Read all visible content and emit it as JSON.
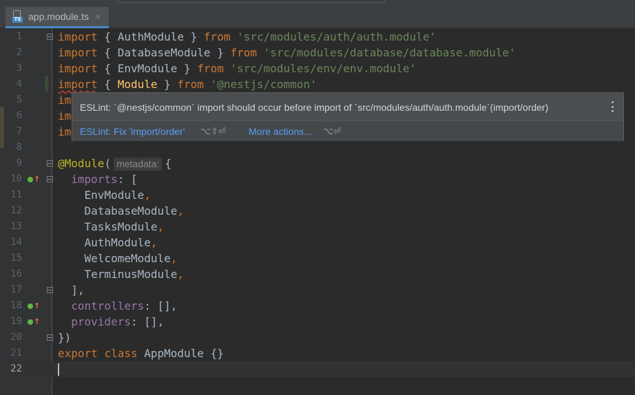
{
  "tab": {
    "file_name": "app.module.ts",
    "badge": "TS",
    "close": "×"
  },
  "code_lines": [
    {
      "num": "1"
    },
    {
      "num": "2"
    },
    {
      "num": "3"
    },
    {
      "num": "4"
    },
    {
      "num": "5"
    },
    {
      "num": "6"
    },
    {
      "num": "7"
    },
    {
      "num": "8"
    },
    {
      "num": "9"
    },
    {
      "num": "10"
    },
    {
      "num": "11"
    },
    {
      "num": "12"
    },
    {
      "num": "13"
    },
    {
      "num": "14"
    },
    {
      "num": "15"
    },
    {
      "num": "16"
    },
    {
      "num": "17"
    },
    {
      "num": "18"
    },
    {
      "num": "19"
    },
    {
      "num": "20"
    },
    {
      "num": "21"
    },
    {
      "num": "22"
    }
  ],
  "code": {
    "l1": [
      "import",
      " { AuthModule } ",
      "from",
      " ",
      "'src/modules/auth/auth.module'"
    ],
    "l2": [
      "import",
      " { DatabaseModule } ",
      "from",
      " ",
      "'src/modules/database/database.module'"
    ],
    "l3": [
      "import",
      " { EnvModule } ",
      "from",
      " ",
      "'src/modules/env/env.module'"
    ],
    "l4": [
      "import",
      " { ",
      "Module",
      " } ",
      "from",
      " ",
      "'@nestjs/common'"
    ],
    "l5": "im",
    "l6": "im",
    "l7": "im",
    "l9": [
      "@Module",
      "(",
      "metadata:",
      "{"
    ],
    "l10": [
      "imports",
      ": ["
    ],
    "l11": [
      "EnvModule",
      ","
    ],
    "l12": [
      "DatabaseModule",
      ","
    ],
    "l13": [
      "TasksModule",
      ","
    ],
    "l14": [
      "AuthModule",
      ","
    ],
    "l15": [
      "WelcomeModule",
      ","
    ],
    "l16": [
      "TerminusModule",
      ","
    ],
    "l17": [
      "],",
      ""
    ],
    "l18": [
      "controllers",
      ": [],"
    ],
    "l19": [
      "providers",
      ": [],"
    ],
    "l20": "})",
    "l21": [
      "export",
      " ",
      "class",
      " AppModule {}"
    ]
  },
  "popup": {
    "message": "ESLint: `@nestjs/common` import should occur before import of `src/modules/auth/auth.module`(import/order)",
    "fix_action": "ESLint: Fix 'import/order'",
    "fix_shortcut": "⌥⇧⏎",
    "more_action": "More actions...",
    "more_shortcut": "⌥⏎"
  },
  "gutter_icon": {
    "arrow": "↑"
  },
  "colors": {
    "background": "#2b2b2b",
    "keyword": "#cc7832",
    "string": "#6a8759",
    "annotation": "#bbb529",
    "property": "#9876aa",
    "link": "#589df6"
  }
}
